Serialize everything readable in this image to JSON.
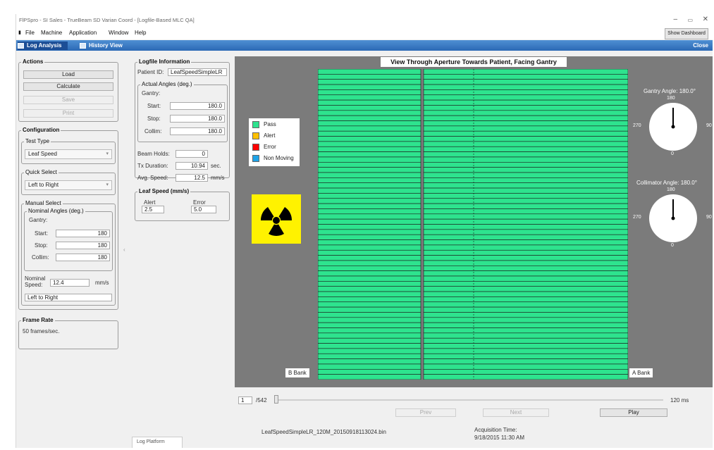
{
  "window": {
    "title": "FlPSpro - SI Sales - TrueBeam SD Varian Coord - [Logfile-Based MLC QA]",
    "menu": [
      "File",
      "Machine",
      "Application",
      "Window",
      "Help"
    ],
    "show_dashboard": "Show Dashboard",
    "tabs": [
      "Log Analysis",
      "History View"
    ],
    "close": "Close"
  },
  "actions": {
    "title": "Actions",
    "load": "Load",
    "calculate": "Calculate",
    "save": "Save",
    "print": "Print"
  },
  "configuration": {
    "title": "Configuration",
    "test_type_label": "Test Type",
    "test_type": "Leaf Speed",
    "quick_select_label": "Quick Select",
    "quick_select": "Left to Right",
    "manual_select_label": "Manual Select",
    "nominal_angles_label": "Nominal Angles (deg.)",
    "gantry_label": "Gantry:",
    "start_label": "Start:",
    "start": "180",
    "stop_label": "Stop:",
    "stop": "180",
    "collim_label": "Collim:",
    "collim": "180",
    "nominal_speed_label_1": "Nominal",
    "nominal_speed_label_2": "Speed:",
    "nominal_speed": "12.4",
    "speed_unit": "mm/s",
    "direction": "Left to Right"
  },
  "frame_rate": {
    "title": "Frame Rate",
    "value": "50 frames/sec."
  },
  "logfile": {
    "title": "Logfile Information",
    "patient_id_label": "Patient ID:",
    "patient_id": "LeafSpeedSimpleLR",
    "actual_angles_label": "Actual Angles (deg.)",
    "gantry_label": "Gantry:",
    "start_label": "Start:",
    "start": "180.0",
    "stop_label": "Stop:",
    "stop": "180.0",
    "collim_label": "Collim:",
    "collim": "180.0",
    "beam_holds_label": "Beam Holds:",
    "beam_holds": "0",
    "tx_duration_label": "Tx Duration:",
    "tx_duration": "10.94",
    "tx_unit": "sec.",
    "avg_speed_label": "Avg. Speed:",
    "avg_speed": "12.5",
    "avg_unit": "mm/s"
  },
  "leaf_speed": {
    "title": "Leaf Speed (mm/s)",
    "alert_label": "Alert",
    "alert": "2.5",
    "error_label": "Error",
    "error": "5.0"
  },
  "view": {
    "title": "View Through Aperture Towards Patient, Facing Gantry",
    "legend": [
      {
        "label": "Pass",
        "color": "#2ee38e"
      },
      {
        "label": "Alert",
        "color": "#ffc000"
      },
      {
        "label": "Error",
        "color": "#ff0000"
      },
      {
        "label": "Non Moving",
        "color": "#1fa3e8"
      }
    ],
    "b_bank": "B Bank",
    "a_bank": "A Bank",
    "leaf_color": "#2ee38e",
    "leaf_pairs": 60,
    "gantry_angle_label": "Gantry Angle: 180.0°",
    "collimator_angle_label": "Collimator Angle: 180.0°",
    "gantry_angle": 180,
    "collimator_angle": 180,
    "dial_labels": {
      "top": "180",
      "left": "270",
      "right": "90",
      "bottom": "0"
    }
  },
  "playback": {
    "frame": "1",
    "total": "/542",
    "interval": "120 ms",
    "prev": "Prev",
    "next": "Next",
    "play": "Play",
    "filename": "LeafSpeedSimpleLR_120M_20150918113024.bin",
    "acq_label": "Acquisition Time:",
    "acq_time": "9/18/2015 11:30 AM"
  },
  "bottom_tab": "Log Platform"
}
